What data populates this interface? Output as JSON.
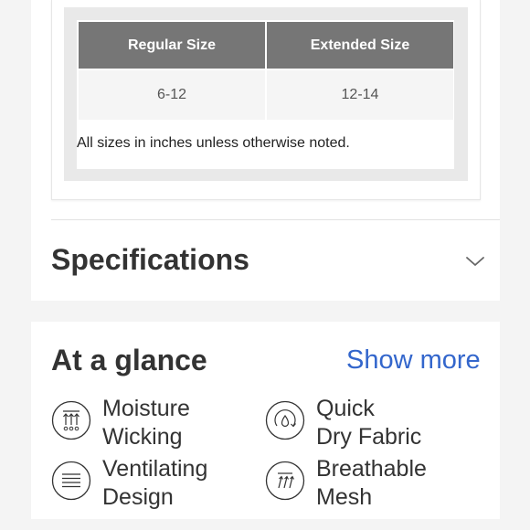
{
  "size_chart": {
    "headers": [
      "Regular Size",
      "Extended Size"
    ],
    "rows": [
      [
        "6-12",
        "12-14"
      ]
    ],
    "note": "All sizes in inches unless otherwise noted."
  },
  "specifications": {
    "title": "Specifications",
    "toggle_icon": "chevron-down-icon"
  },
  "at_a_glance": {
    "title": "At a glance",
    "show_more_label": "Show more",
    "features": [
      {
        "line1": "Moisture",
        "line2": "Wicking",
        "icon": "moisture-wicking-icon"
      },
      {
        "line1": "Quick",
        "line2": "Dry Fabric",
        "icon": "quick-dry-icon"
      },
      {
        "line1": "Ventilating",
        "line2": "Design",
        "icon": "ventilating-icon"
      },
      {
        "line1": "Breathable",
        "line2": "Mesh",
        "icon": "breathable-mesh-icon"
      }
    ]
  },
  "colors": {
    "link": "#3366cc",
    "table_header": "#767676",
    "text": "#333333"
  }
}
